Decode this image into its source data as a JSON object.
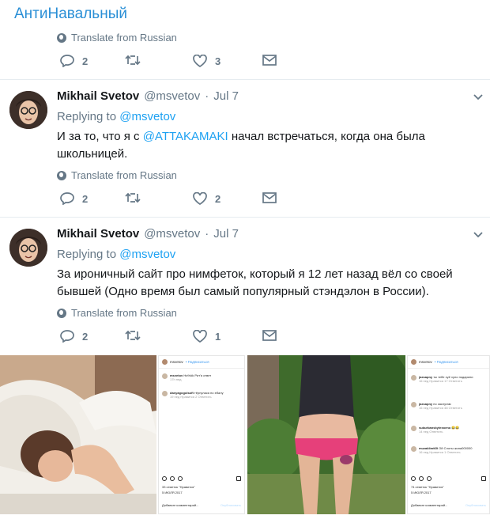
{
  "channel": {
    "title": "АнтиНавальный"
  },
  "colors": {
    "accent": "#1da1f2",
    "muted": "#657786",
    "title": "#2a8fd6"
  },
  "top_tweet": {
    "translate": "Translate from Russian",
    "actions": {
      "replies": "2",
      "likes": "3"
    }
  },
  "tweets": [
    {
      "name": "Mikhail Svetov",
      "handle": "@msvetov",
      "sep": "·",
      "date": "Jul 7",
      "replying_label": "Replying to",
      "replying_to": "@msvetov",
      "text_before": "И за то, что я с ",
      "mention": "@ATTAKAMAKI",
      "text_after": " начал встречаться, когда она была школьницей.",
      "translate": "Translate from Russian",
      "actions": {
        "replies": "2",
        "likes": "2"
      }
    },
    {
      "name": "Mikhail Svetov",
      "handle": "@msvetov",
      "sep": "·",
      "date": "Jul 7",
      "replying_label": "Replying to",
      "replying_to": "@msvetov",
      "text": "За ироничный сайт про нимфеток, который я 12 лет назад вёл со своей бывшей (Одно время был самый популярный стэндэлон в России).",
      "translate": "Translate from Russian",
      "actions": {
        "replies": "2",
        "likes": "1"
      }
    }
  ],
  "instagram_1": {
    "user": "msvetov",
    "follow": "• Подписаться",
    "comments": [
      {
        "user": "msvetov",
        "text": "Ни%#k Рит'я ответ",
        "meta": "17h нед"
      },
      {
        "user": "danyagogolsoft",
        "text": "тёрнулася по ебалу",
        "meta": "19 нед  Нравится 2  Ответить"
      }
    ],
    "likes": "33 отметок \"Нравится\"",
    "date": "5 ИЮЛЯ 2017",
    "add_comment": "Добавьте комментарий...",
    "publish": "Опубликовать"
  },
  "instagram_2": {
    "user": "msvetov",
    "follow": "• Подписаться",
    "comments": [
      {
        "user": "jaxsapny",
        "text": "ты тебе хуё хуло подарили",
        "meta": "16 нед  Нравится 17  Ответить"
      },
      {
        "user": "jaxsapny",
        "text": "по заслугам",
        "meta": "16 нед  Нравится 48  Ответить"
      },
      {
        "user": "suburbanskytexoeno",
        "text": "😂😂",
        "meta": "14 нед  Ответить"
      },
      {
        "user": "muzaklimt69",
        "text": "Ой Слоты жопа000000",
        "meta": "16 нед  Нравится 1  Ответить"
      }
    ],
    "likes": "74 отметок \"Нравится\"",
    "date": "5 ИЮЛЯ 2017",
    "add_comment": "Добавьте комментарий...",
    "publish": "Опубликовать"
  }
}
